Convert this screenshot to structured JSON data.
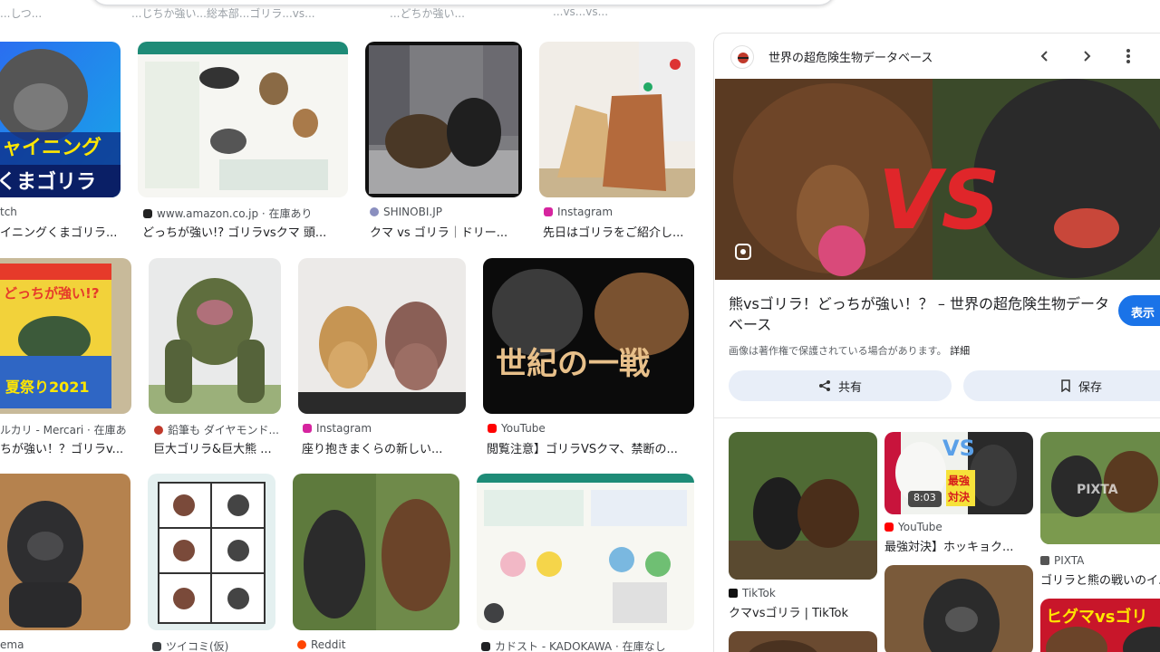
{
  "top": {
    "faded_texts": [
      "...しつ...",
      "...じちか強い...総本部...ゴリラ...vs...",
      "...どちか強い...",
      "...vs...vs..."
    ]
  },
  "results": [
    {
      "source": "tch",
      "title": "イニングくまゴリラ...",
      "fav_color": "#6a6a6a",
      "thumb_text": "ャイニング\nくまゴリラ"
    },
    {
      "source": "www.amazon.co.jp · 在庫あり",
      "title": "どっちが強い!? ゴリラvsクマ 頭...",
      "fav_color": "#222222"
    },
    {
      "source": "SHINOBI.JP",
      "title": "クマ vs ゴリラ｜ドリー...",
      "fav_color": "#8a8fbf"
    },
    {
      "source": "Instagram",
      "title": "先日はゴリラをご紹介し...",
      "fav_color": "#d6249f"
    },
    {
      "source": "ルカリ - Mercari · 在庫あり",
      "title": "ちが強い！？ゴリラv...",
      "fav_color": "#4b6cff",
      "thumb_text": "どっちが強い!?\n夏祭り2021"
    },
    {
      "source": "鉛筆も ダイヤモンド...",
      "title": "巨大ゴリラ&巨大熊 ...",
      "fav_color": "#c0392b"
    },
    {
      "source": "Instagram",
      "title": "座り抱きまくらの新しい...",
      "fav_color": "#d6249f"
    },
    {
      "source": "YouTube",
      "title": "閲覧注意】ゴリラVSクマ、禁断の...",
      "fav_color": "#ff0000",
      "thumb_text": "世紀の一戦"
    },
    {
      "source": "ema",
      "title": "",
      "fav_color": "#888888"
    },
    {
      "source": "ツイコミ(仮)",
      "title": "",
      "fav_color": "#3c4043"
    },
    {
      "source": "Reddit",
      "title": "",
      "fav_color": "#ff4500"
    },
    {
      "source": "カドスト - KADOKAWA · 在庫なし",
      "title": "",
      "fav_color": "#202124"
    }
  ],
  "panel": {
    "site_name": "世界の超危険生物データベース",
    "hero_text": "VS",
    "title": "熊vsゴリラ！どっちが強い！？ – 世界の超危険生物データベース",
    "visit_label": "表示",
    "copyright_note": "画像は著作権で保護されている場合があります。",
    "detail_label": "詳細",
    "share_label": "共有",
    "save_label": "保存",
    "related": [
      {
        "source": "TikTok",
        "title": "クマvsゴリラ | TikTok",
        "fav_color": "#111111"
      },
      {
        "source": "YouTube",
        "title": "最強対決】ホッキョク...",
        "fav_color": "#ff0000",
        "duration": "8:03",
        "thumb_text": "最強\n対決",
        "thumb_vs": "VS"
      },
      {
        "source": "PIXTA",
        "title": "ゴリラと熊の戦いのイ...",
        "fav_color": "#555555",
        "watermark": "PIXTA"
      },
      {
        "source": "",
        "title": "",
        "fav_color": "#ffffff",
        "thumb_text": "ヒグマvsゴリ"
      }
    ]
  },
  "colors": {
    "accent": "#1a73e8",
    "share_bg": "#e8eef8",
    "youtube": "#ff0000"
  }
}
